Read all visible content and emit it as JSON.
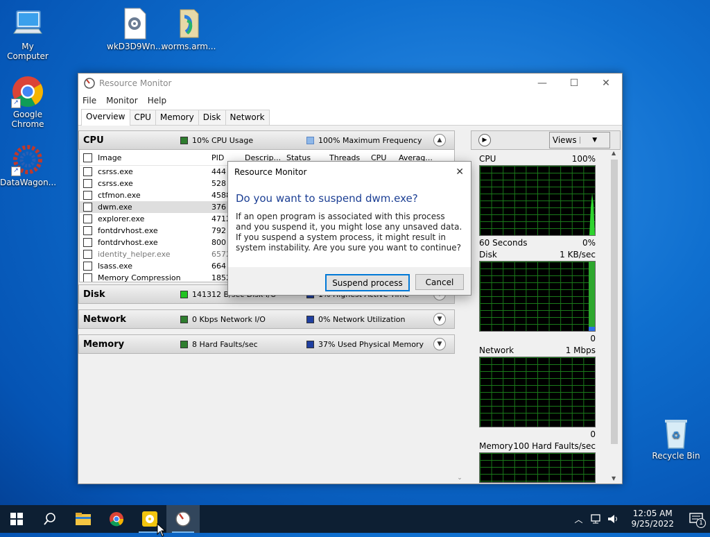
{
  "desktop": {
    "icons": [
      {
        "label": "My Computer"
      },
      {
        "label": "wkD3D9Wn..."
      },
      {
        "label": "worms.arm..."
      },
      {
        "label": "Google Chrome"
      },
      {
        "label": "DataWagon..."
      },
      {
        "label": "Recycle Bin"
      }
    ]
  },
  "window": {
    "title": "Resource Monitor",
    "menu": [
      "File",
      "Monitor",
      "Help"
    ],
    "tabs": [
      "Overview",
      "CPU",
      "Memory",
      "Disk",
      "Network"
    ],
    "active_tab": "Overview"
  },
  "sections": {
    "cpu": {
      "name": "CPU",
      "m1": "10% CPU Usage",
      "m2": "100% Maximum Frequency",
      "m1_color": "#2e7d2e",
      "m2_color": "#8fb8e8"
    },
    "disk": {
      "name": "Disk",
      "m1": "141312 B/sec Disk I/O",
      "m2": "1% Highest Active Time",
      "m1_color": "#22c322",
      "m2_color": "#1f3fa0"
    },
    "network": {
      "name": "Network",
      "m1": "0 Kbps Network I/O",
      "m2": "0% Network Utilization",
      "m1_color": "#2e7d2e",
      "m2_color": "#1f3fa0"
    },
    "memory": {
      "name": "Memory",
      "m1": "8 Hard Faults/sec",
      "m2": "37% Used Physical Memory",
      "m1_color": "#2e7d2e",
      "m2_color": "#1f3fa0"
    }
  },
  "cpu_table": {
    "headers": {
      "image": "Image",
      "pid": "PID",
      "desc": "Descrip...",
      "status": "Status",
      "threads": "Threads",
      "cpu": "CPU",
      "avg": "Averag..."
    },
    "rows": [
      {
        "image": "csrss.exe",
        "pid": "444"
      },
      {
        "image": "csrss.exe",
        "pid": "528"
      },
      {
        "image": "ctfmon.exe",
        "pid": "4588"
      },
      {
        "image": "dwm.exe",
        "pid": "376"
      },
      {
        "image": "explorer.exe",
        "pid": "4712"
      },
      {
        "image": "fontdrvhost.exe",
        "pid": "792"
      },
      {
        "image": "fontdrvhost.exe",
        "pid": "800"
      },
      {
        "image": "identity_helper.exe",
        "pid": "6572"
      },
      {
        "image": "lsass.exe",
        "pid": "664"
      },
      {
        "image": "Memory Compression",
        "pid": "1852"
      }
    ]
  },
  "right_panel": {
    "views_label": "Views",
    "graphs": [
      {
        "name": "CPU",
        "max": "100%",
        "foot_left": "60 Seconds",
        "foot_right": "0%"
      },
      {
        "name": "Disk",
        "max": "1 KB/sec",
        "foot_left": "",
        "foot_right": "0"
      },
      {
        "name": "Network",
        "max": "1 Mbps",
        "foot_left": "",
        "foot_right": "0"
      },
      {
        "name": "Memory",
        "max": "100 Hard Faults/sec",
        "foot_left": "",
        "foot_right": ""
      }
    ]
  },
  "dialog": {
    "title": "Resource Monitor",
    "question": "Do you want to suspend dwm.exe?",
    "body": "If an open program is associated with this process and you suspend it, you might lose any unsaved data. If you suspend a system process, it might result in system instability. Are you sure you want to continue?",
    "primary_label": "Suspend process",
    "cancel_label": "Cancel"
  },
  "taskbar": {
    "time": "12:05 AM",
    "date": "9/25/2022",
    "notification_count": "1"
  }
}
